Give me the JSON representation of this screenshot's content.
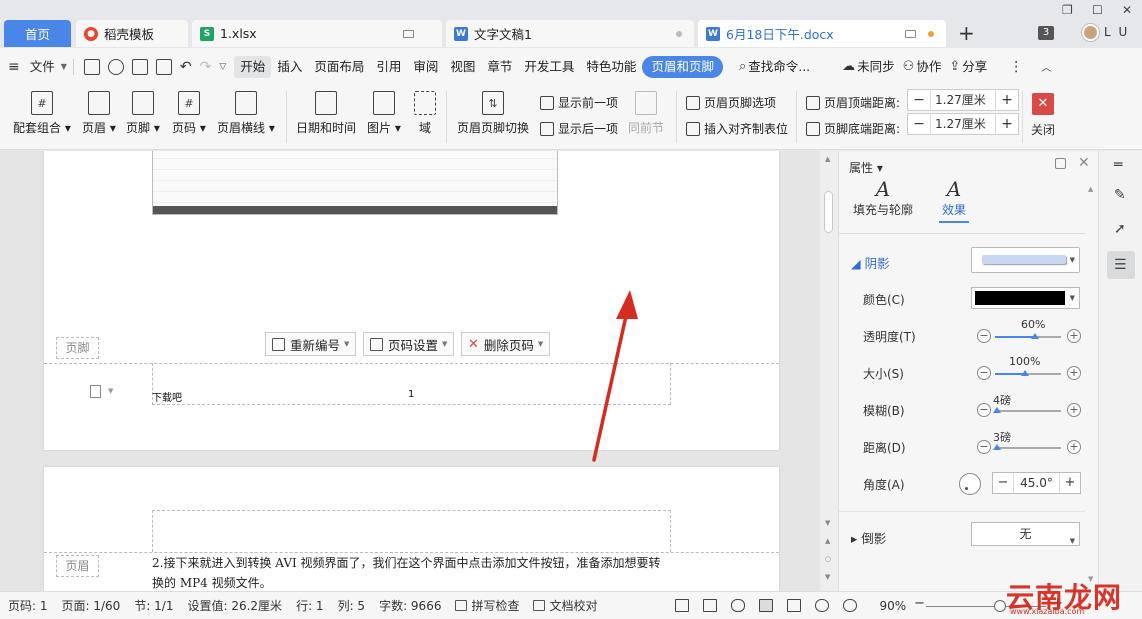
{
  "tabs": {
    "home": "首页",
    "t1": "稻壳模板",
    "t2": "1.xlsx",
    "t3": "文字文稿1",
    "t4": "6月18日下午.docx",
    "count": "3",
    "user": "L U"
  },
  "menu": {
    "file": "文件",
    "items": [
      "开始",
      "插入",
      "页面布局",
      "引用",
      "审阅",
      "视图",
      "章节",
      "开发工具",
      "特色功能",
      "页眉和页脚"
    ],
    "search": "查找命令...",
    "sync": "未同步",
    "collab": "协作",
    "share": "分享"
  },
  "ribbon": {
    "combo": "配套组合",
    "header": "页眉",
    "footer": "页脚",
    "page_num": "页码",
    "header_line": "页眉横线",
    "datetime": "日期和时间",
    "picture": "图片",
    "field": "域",
    "switch": "页眉页脚切换",
    "show_prev": "显示前一项",
    "show_next": "显示后一项",
    "same_prev": "同前节",
    "options": "页眉页脚选项",
    "insert_tab": "插入对齐制表位",
    "top_dist_label": "页眉顶端距离:",
    "top_dist_val": "1.27厘米",
    "bottom_dist_label": "页脚底端距离:",
    "bottom_dist_val": "1.27厘米",
    "close": "关闭"
  },
  "doc": {
    "footer_label": "页脚",
    "header_label": "页眉",
    "renumber": "重新编号",
    "page_setup": "页码设置",
    "delete_num": "删除页码",
    "footer_text": "下载吧",
    "footer_num": "1",
    "body_text": "2.接下来就进入到转换 AVI 视频界面了，我们在这个界面中点击添加文件按钮，准备添加想要转换的 MP4 视频文件。"
  },
  "panel": {
    "title": "属性",
    "tab_fill": "填充与轮廓",
    "tab_effect": "效果",
    "shadow": "阴影",
    "color": "颜色(C)",
    "transparency": "透明度(T)",
    "transparency_val": "60%",
    "size": "大小(S)",
    "size_val": "100%",
    "blur": "模糊(B)",
    "blur_val": "4磅",
    "distance": "距离(D)",
    "distance_val": "3磅",
    "angle": "角度(A)",
    "angle_val": "45.0°",
    "reflection": "倒影",
    "reflection_val": "无"
  },
  "status": {
    "page": "页码: 1",
    "pages": "页面: 1/60",
    "section": "节: 1/1",
    "setting": "设置值: 26.2厘米",
    "row": "行: 1",
    "col": "列: 5",
    "words": "字数: 9666",
    "spell": "拼写检查",
    "proof": "文档校对",
    "zoom": "90%"
  },
  "watermark": {
    "main": "云南龙网",
    "sub": "www.xiazaiba.com"
  },
  "colors": {
    "accent": "#4a86e8",
    "close_red": "#d94a46",
    "arrow_red": "#d62b1f"
  }
}
